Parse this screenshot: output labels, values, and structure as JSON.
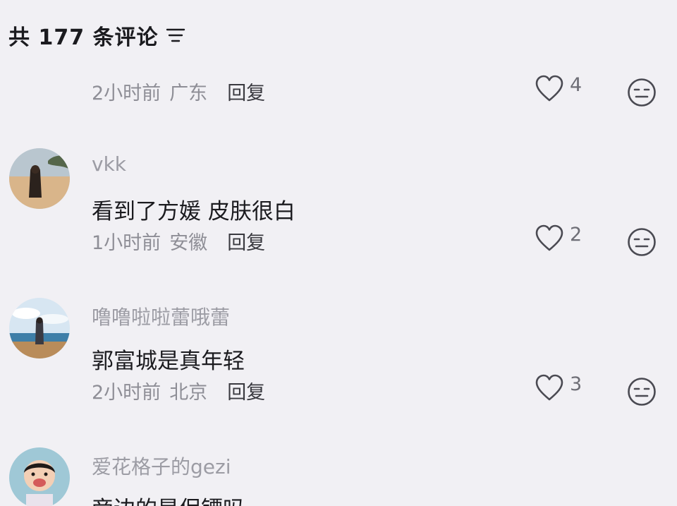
{
  "header": {
    "title": "共 177 条评论",
    "filter_icon": "filter-lines-icon"
  },
  "comments": [
    {
      "username": "",
      "content": "",
      "time": "2小时前",
      "location": "广东",
      "reply": "回复",
      "likes": "4"
    },
    {
      "username": "vkk",
      "content": "看到了方媛 皮肤很白",
      "time": "1小时前",
      "location": "安徽",
      "reply": "回复",
      "likes": "2"
    },
    {
      "username": "噜噜啦啦蕾哦蕾",
      "content": "郭富城是真年轻",
      "time": "2小时前",
      "location": "北京",
      "reply": "回复",
      "likes": "3"
    },
    {
      "username": "爱花格子的gezi",
      "content": "旁边的是保镖吗"
    }
  ],
  "icons": {
    "like": "heart-outline-icon",
    "dislike": "meh-face-icon"
  },
  "colors": {
    "background": "#f1f0f4",
    "primary_text": "#1b1b1f",
    "secondary_text": "#9c9ca4"
  }
}
